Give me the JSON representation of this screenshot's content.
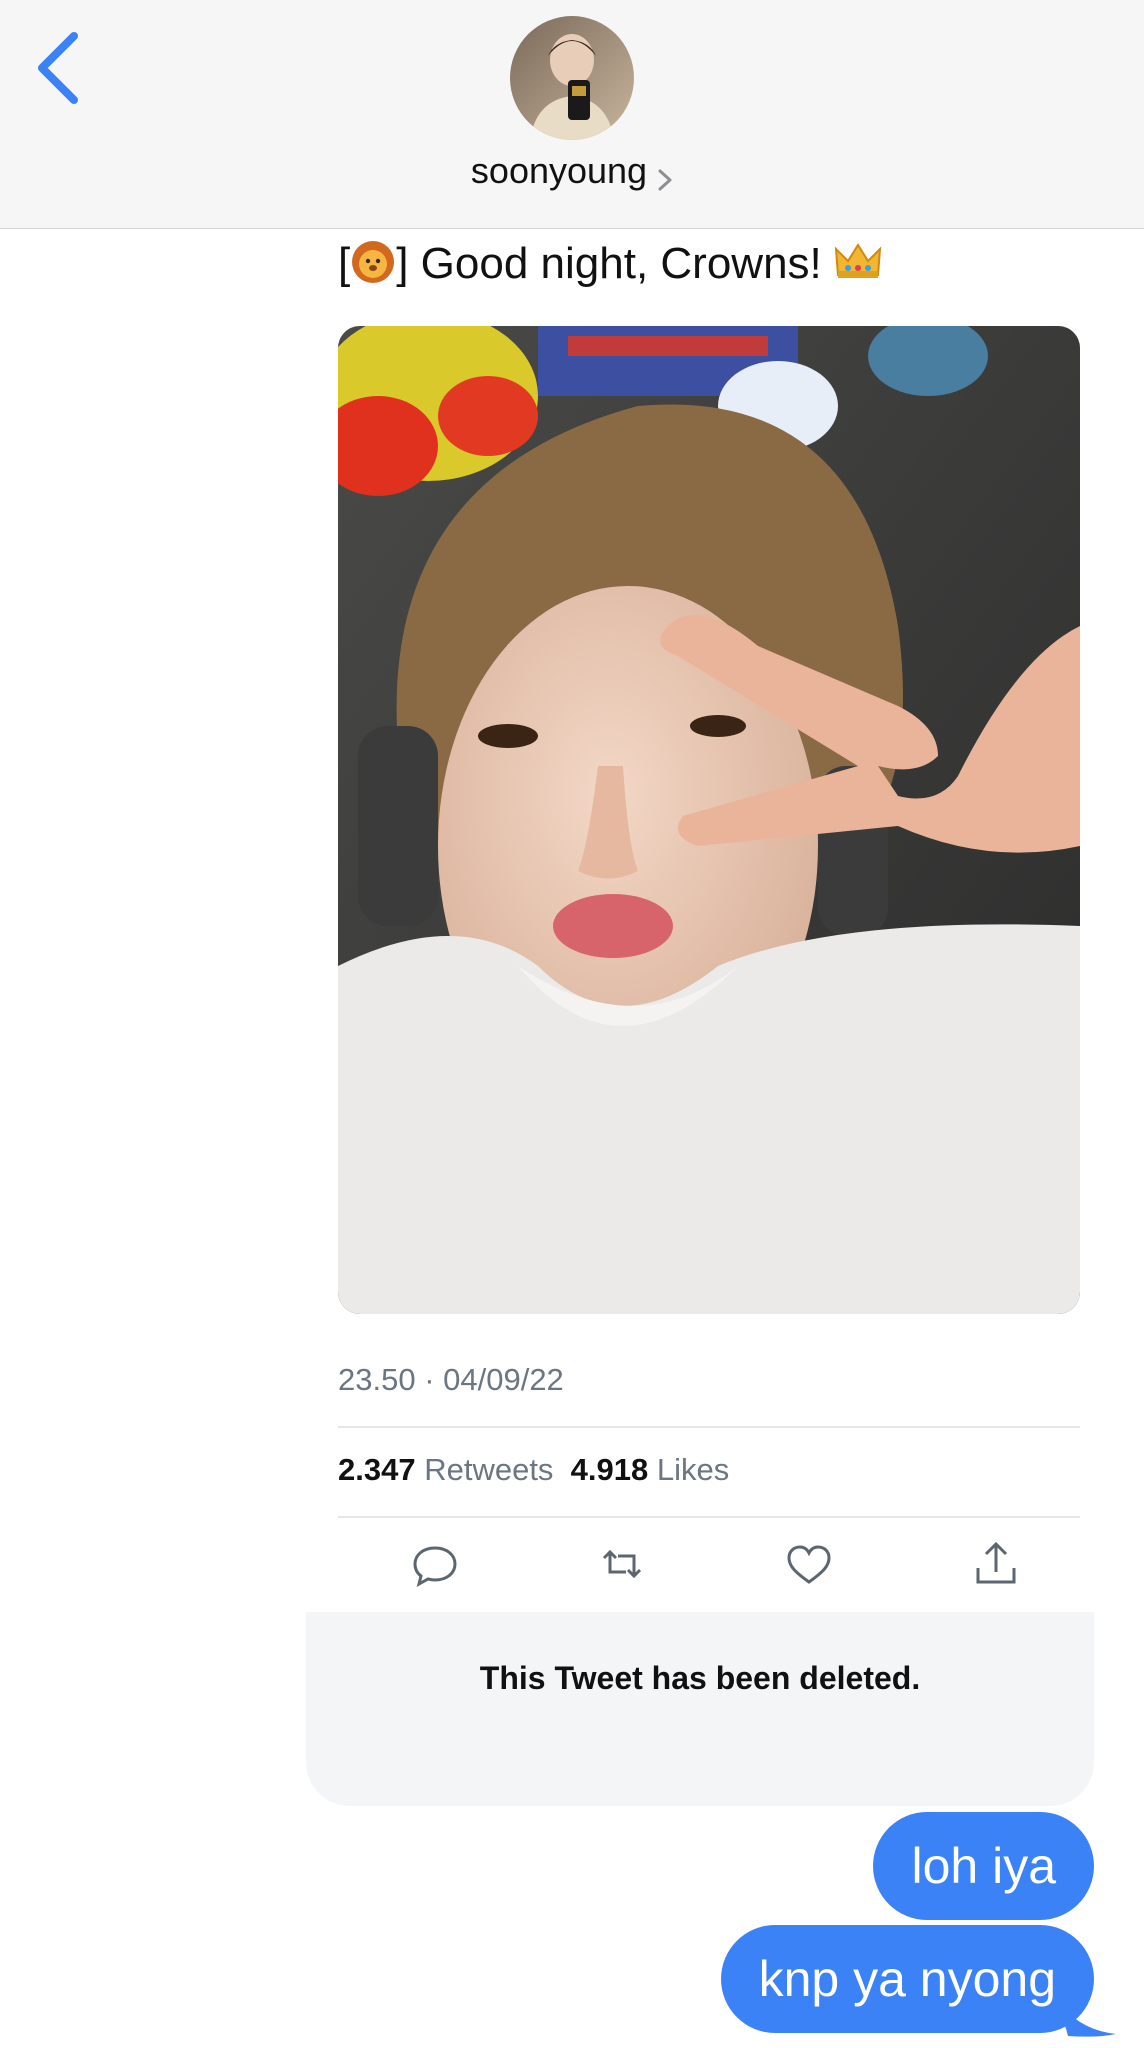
{
  "header": {
    "contact_name": "soonyoung",
    "back_icon": "chevron-left-icon",
    "avatar": "profile-photo"
  },
  "tweet": {
    "text": "] Good night, Crowns!",
    "text_prefix": "[",
    "timestamp": "23.50 · 04/09/22",
    "retweets_count": "2.347",
    "retweets_label": "Retweets",
    "likes_count": "4.918",
    "likes_label": "Likes",
    "actions": [
      "reply-icon",
      "retweet-icon",
      "like-icon",
      "share-icon"
    ]
  },
  "deleted_notice": "This Tweet has been deleted.",
  "messages": [
    {
      "text": "loh iya",
      "sender": "me"
    },
    {
      "text": "knp ya nyong",
      "sender": "me"
    }
  ],
  "colors": {
    "accent": "#3b82f6",
    "secondary_text": "#6b7682",
    "header_bg": "#f6f6f7"
  }
}
